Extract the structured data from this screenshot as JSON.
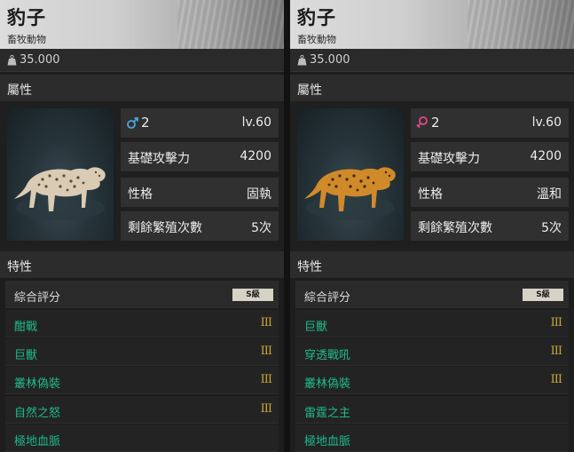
{
  "colors": {
    "trait_text": "#1fb98d",
    "level_text": "#c9a53a",
    "male": "#4aa8e0",
    "female": "#e04a8a",
    "badge_bg": "#d6d2c6"
  },
  "panels": [
    {
      "title": "豹子",
      "subtitle": "畜牧動物",
      "price": "35.000",
      "section_attributes": "屬性",
      "gender_icon": "male-icon",
      "count": "2",
      "level": "lv.60",
      "stats": [
        {
          "label": "基礎攻擊力",
          "value": "4200"
        },
        {
          "label": "性格",
          "value": "固執"
        },
        {
          "label": "剩餘繁殖次數",
          "value": "5次"
        }
      ],
      "section_traits": "特性",
      "overall_label": "綜合評分",
      "overall_grade": "S級",
      "traits": [
        {
          "name": "酣戰",
          "level": "III"
        },
        {
          "name": "巨獸",
          "level": "III"
        },
        {
          "name": "叢林偽裝",
          "level": "III"
        },
        {
          "name": "自然之怒",
          "level": "III"
        },
        {
          "name": "極地血脈",
          "level": ""
        }
      ]
    },
    {
      "title": "豹子",
      "subtitle": "畜牧動物",
      "price": "35.000",
      "section_attributes": "屬性",
      "gender_icon": "female-icon",
      "count": "2",
      "level": "lv.60",
      "stats": [
        {
          "label": "基礎攻擊力",
          "value": "4200"
        },
        {
          "label": "性格",
          "value": "溫和"
        },
        {
          "label": "剩餘繁殖次數",
          "value": "5次"
        }
      ],
      "section_traits": "特性",
      "overall_label": "綜合評分",
      "overall_grade": "S級",
      "traits": [
        {
          "name": "巨獸",
          "level": "III"
        },
        {
          "name": "穿透戰吼",
          "level": "III"
        },
        {
          "name": "叢林偽裝",
          "level": "III"
        },
        {
          "name": "雷霆之主",
          "level": ""
        },
        {
          "name": "極地血脈",
          "level": ""
        }
      ]
    }
  ]
}
